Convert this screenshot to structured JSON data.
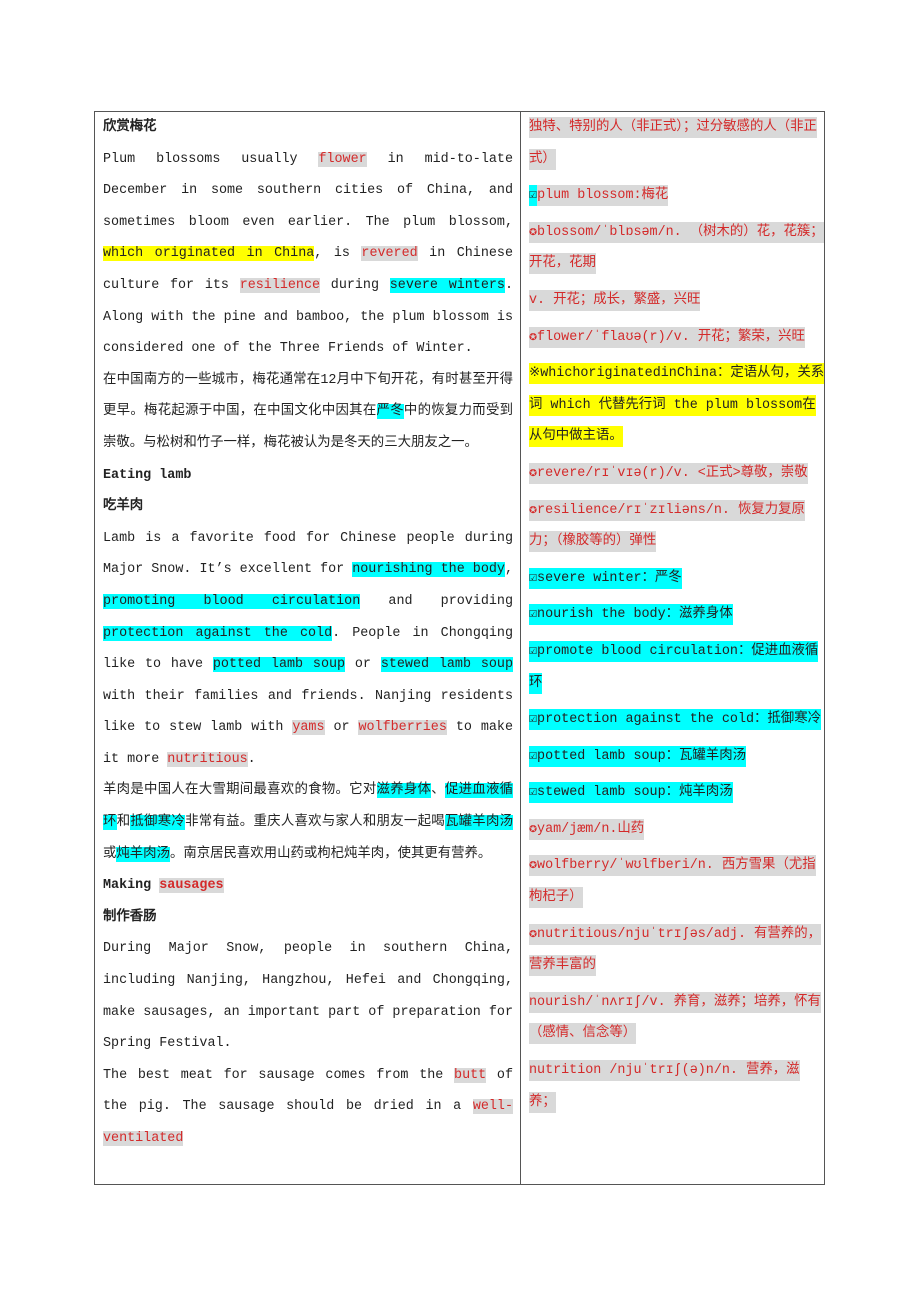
{
  "left": [
    [
      {
        "t": "欣赏梅花",
        "s": "b"
      }
    ],
    [
      {
        "t": "Plum blossoms usually "
      },
      {
        "t": "flower",
        "s": "g"
      },
      {
        "t": " in mid-to-late December in some southern cities of China, and sometimes bloom even earlier. The plum blossom, "
      },
      {
        "t": "which originated in China",
        "s": "y"
      },
      {
        "t": ", is "
      },
      {
        "t": "revered",
        "s": "g"
      },
      {
        "t": " in Chinese culture for its "
      },
      {
        "t": "resilience",
        "s": "g"
      },
      {
        "t": " during "
      },
      {
        "t": "severe winters",
        "s": "c"
      },
      {
        "t": ". Along with the pine and bamboo, the plum blossom is considered one of the Three Friends of Winter."
      }
    ],
    [
      {
        "t": "在中国南方的一些城市，梅花通常在12月中下旬开花，有时甚至开得更早。梅花起源于中国，在中国文化中因其在"
      },
      {
        "t": "严冬",
        "s": "c"
      },
      {
        "t": "中的恢复力而受到崇敬。与松树和竹子一样，梅花被认为是冬天的三大朋友之一。"
      }
    ],
    [
      {
        "t": "Eating lamb",
        "s": "b"
      }
    ],
    [
      {
        "t": "吃羊肉",
        "s": "b"
      }
    ],
    [
      {
        "t": "Lamb is a favorite food for Chinese people during Major Snow. It’s excellent for "
      },
      {
        "t": "nourishing the body",
        "s": "c"
      },
      {
        "t": ", "
      },
      {
        "t": "promoting blood circulation",
        "s": "c"
      },
      {
        "t": " and providing "
      },
      {
        "t": "protection against the cold",
        "s": "c"
      },
      {
        "t": ". People in Chongqing like to have "
      },
      {
        "t": "potted lamb soup",
        "s": "c"
      },
      {
        "t": " or "
      },
      {
        "t": "stewed lamb soup",
        "s": "c"
      },
      {
        "t": " with their families and friends. Nanjing residents like to stew lamb with "
      },
      {
        "t": "yams",
        "s": "g"
      },
      {
        "t": " or "
      },
      {
        "t": "wolfberries",
        "s": "g"
      },
      {
        "t": " to make it more "
      },
      {
        "t": "nutritious",
        "s": "g"
      },
      {
        "t": "."
      }
    ],
    [
      {
        "t": "羊肉是中国人在大雪期间最喜欢的食物。它对"
      },
      {
        "t": "滋养身体",
        "s": "c"
      },
      {
        "t": "、"
      },
      {
        "t": "促进血液循环",
        "s": "c"
      },
      {
        "t": "和"
      },
      {
        "t": "抵御寒冷",
        "s": "c"
      },
      {
        "t": "非常有益。重庆人喜欢与家人和朋友一起喝"
      },
      {
        "t": "瓦罐羊肉汤",
        "s": "c"
      },
      {
        "t": "或"
      },
      {
        "t": "炖羊肉汤",
        "s": "c"
      },
      {
        "t": "。南京居民喜欢用山药或枸杞炖羊肉，使其更有营养。"
      }
    ],
    [
      {
        "t": "Making ",
        "s": "b"
      },
      {
        "t": "sausages",
        "s": "g b"
      }
    ],
    [
      {
        "t": "制作香肠",
        "s": "b"
      }
    ],
    [
      {
        "t": "During Major Snow, people in southern China, including Nanjing, Hangzhou, Hefei and Chongqing, make sausages, an important part of preparation for Spring Festival."
      }
    ],
    [
      {
        "t": "The best meat for sausage comes from the "
      },
      {
        "t": "butt",
        "s": "g"
      },
      {
        "t": " of the pig. The sausage should be dried in a "
      },
      {
        "t": "well-ventilated",
        "s": "g"
      }
    ]
  ],
  "right": [
    [
      {
        "t": "独特、特别的人（非正式）；过分敏感的人（非正式）",
        "s": "g"
      }
    ],
    [
      {
        "t": "☑",
        "s": "c"
      },
      {
        "t": "plum blossom:梅花",
        "s": "g k"
      }
    ],
    [
      {
        "t": "✪blossom/ˈblɒsəm/n. （树木的）花，花簇；开花，花期",
        "s": "g"
      }
    ],
    [
      {
        "t": "v. 开花；成长，繁盛，兴旺",
        "s": "g"
      }
    ],
    [
      {
        "t": "✪flower/ˈflaʊə(r)/v. 开花；繁荣，兴旺",
        "s": "g"
      }
    ],
    [
      {
        "t": "※whichoriginatedinChina：定语从句，关系词 which 代替先行词 the plum blossom在从句中做主语。",
        "s": "y"
      }
    ],
    [
      {
        "t": "✪revere/rɪˈvɪə(r)/v. <正式>尊敬，崇敬",
        "s": "g"
      }
    ],
    [
      {
        "t": "✪resilience/rɪˈzɪliəns/n. 恢复力复原力；（橡胶等的）弹性",
        "s": "g"
      }
    ],
    [
      {
        "t": "☑severe winter：严冬",
        "s": "c"
      }
    ],
    [
      {
        "t": "☑nourish the body：滋养身体",
        "s": "c"
      }
    ],
    [
      {
        "t": "☑promote blood circulation：促进血液循环",
        "s": "c"
      }
    ],
    [
      {
        "t": "☑protection against the cold：抵御寒冷",
        "s": "c"
      }
    ],
    [
      {
        "t": "☑potted lamb soup：瓦罐羊肉汤",
        "s": "c"
      }
    ],
    [
      {
        "t": "☑stewed lamb soup：炖羊肉汤",
        "s": "c"
      }
    ],
    [
      {
        "t": "✪yam/jæm/n.山药",
        "s": "g"
      }
    ],
    [
      {
        "t": "✪wolfberry/ˈwʊlfberi/n. 西方雪果（尤指枸杞子）",
        "s": "g"
      }
    ],
    [
      {
        "t": "✪nutritious/njuˈtrɪʃəs/adj. 有营养的，营养丰富的",
        "s": "g"
      }
    ],
    [
      {
        "t": "nourish/ˈnʌrɪʃ/v. 养育，滋养；培养，怀有（感情、信念等）",
        "s": "g"
      }
    ],
    [
      {
        "t": "nutrition /njuˈtrɪʃ(ə)n/n. 营养，滋养；",
        "s": "g"
      }
    ]
  ],
  "colors": {
    "yellow_highlight": "#ffff00",
    "cyan_highlight": "#00ffff",
    "gray_highlight": "#d9d9d9",
    "red_text": "#d42a2a"
  }
}
